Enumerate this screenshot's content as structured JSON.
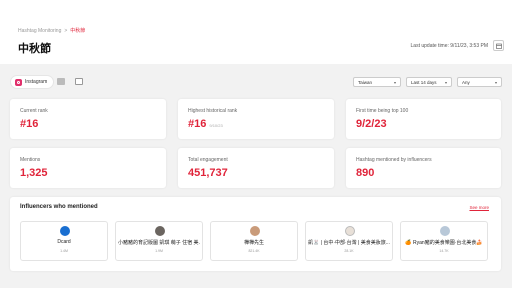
{
  "breadcrumb": {
    "parent": "Hashtag Monitoring",
    "separator": ">",
    "current": "中秋節"
  },
  "page_title": "中秋節",
  "last_update": "Last update time: 9/11/23, 3:53 PM",
  "filters": {
    "platform": "Instagram",
    "region": "Taiwan",
    "period": "Last 14 days",
    "type": "Any"
  },
  "stats": [
    {
      "label": "Current rank",
      "value": "#16",
      "sub": ""
    },
    {
      "label": "Highest historical rank",
      "value": "#16",
      "sub": "9/10/23"
    },
    {
      "label": "First time being top 100",
      "value": "9/2/23",
      "sub": ""
    },
    {
      "label": "Mentions",
      "value": "1,325",
      "sub": ""
    },
    {
      "label": "Total engagement",
      "value": "451,737",
      "sub": ""
    },
    {
      "label": "Hashtag mentioned by influencers",
      "value": "890",
      "sub": ""
    }
  ],
  "influencers": {
    "title": "Influencers who mentioned",
    "see_more": "See more",
    "items": [
      {
        "name": "Dcard",
        "count": "1.4M"
      },
      {
        "name": "小豬豬的育記版圖 凱琪 萌子 住宿 美...",
        "count": "1.9M"
      },
      {
        "name": "樺樺先生",
        "count": "821.4K"
      },
      {
        "name": "凱🐰 | 台中·中部·台灣 | 美食美妝旅...",
        "count": "28.1K"
      },
      {
        "name": "🍊 Ryan豬的美食樂園·台北美食🍰",
        "count": "14.7K"
      }
    ]
  },
  "colors": {
    "accent": "#e0243a",
    "background": "#f2f2f2",
    "card": "#ffffff"
  }
}
